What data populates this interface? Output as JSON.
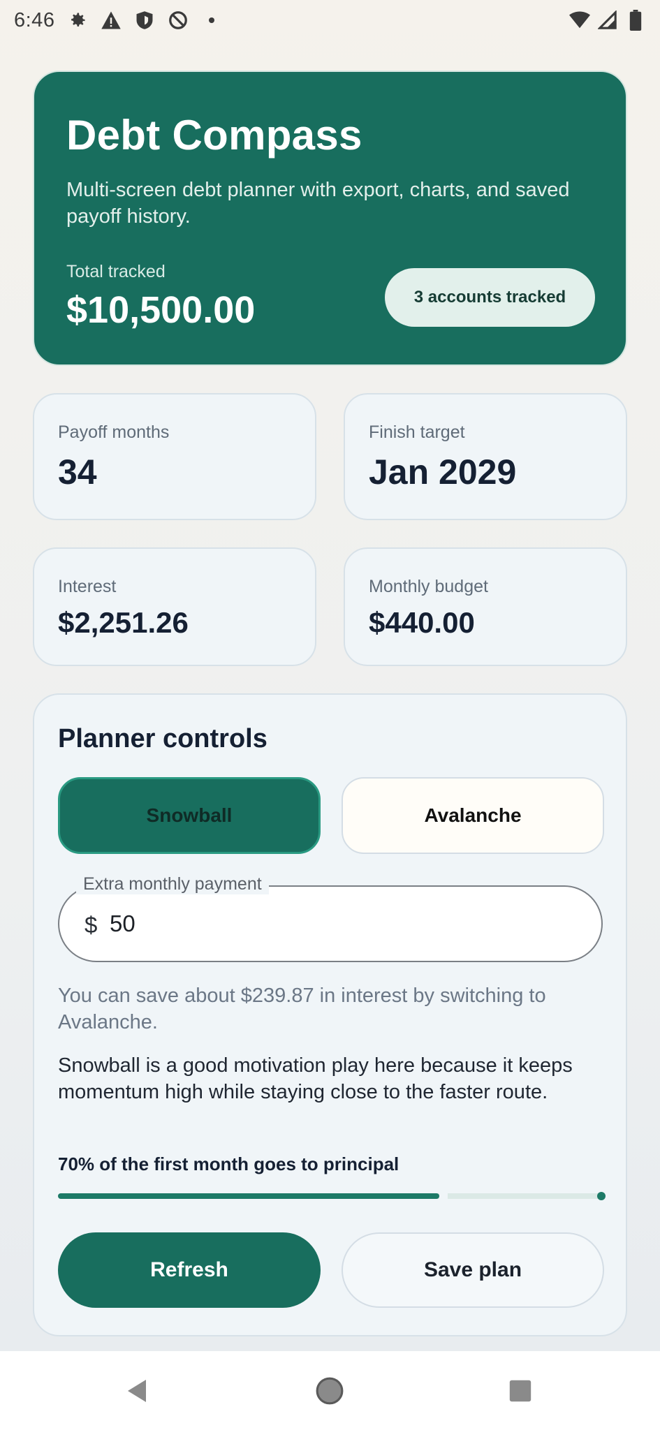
{
  "status_bar": {
    "time": "6:46",
    "icons_left": [
      "gear-icon",
      "warning-icon",
      "shield-icon",
      "no-sync-icon",
      "dot-icon"
    ],
    "icons_right": [
      "wifi-icon",
      "signal-icon",
      "battery-icon"
    ]
  },
  "hero": {
    "title": "Debt Compass",
    "subtitle": "Multi-screen debt planner with export, charts, and saved payoff history.",
    "total_label": "Total tracked",
    "total_value": "$10,500.00",
    "badge": "3 accounts tracked"
  },
  "stats": {
    "payoff_months": {
      "label": "Payoff months",
      "value": "34"
    },
    "finish_target": {
      "label": "Finish target",
      "value": "Jan 2029"
    },
    "interest": {
      "label": "Interest",
      "value": "$2,251.26"
    },
    "monthly_budget": {
      "label": "Monthly budget",
      "value": "$440.00"
    }
  },
  "planner": {
    "title": "Planner controls",
    "strategies": [
      "Snowball",
      "Avalanche"
    ],
    "selected_strategy": "Snowball",
    "extra_payment": {
      "label": "Extra monthly payment",
      "prefix": "$",
      "value": "50"
    },
    "tip": "You can save about $239.87 in interest by switching to Avalanche.",
    "advice": "Snowball is a good motivation play here because it keeps momentum high while staying close to the faster route.",
    "progress_label": "70% of the first month goes to principal",
    "progress_fraction": 0.7,
    "refresh_label": "Refresh",
    "save_label": "Save plan"
  },
  "colors": {
    "accent": "#186e5e",
    "badge_bg": "#e2f0eb",
    "card_bg": "#f0f5f8"
  }
}
